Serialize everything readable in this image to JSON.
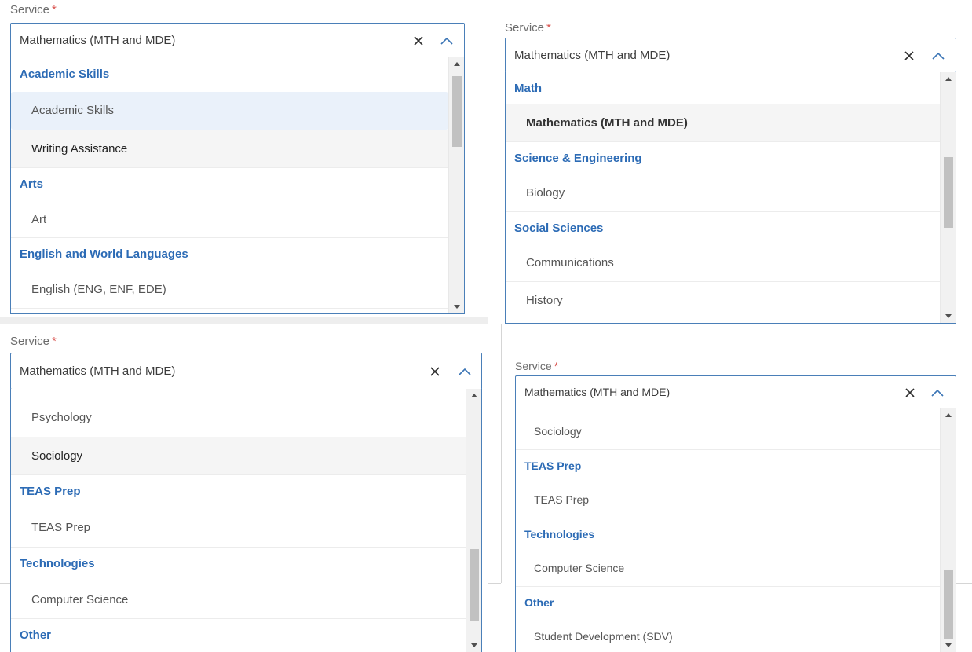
{
  "colors": {
    "accent_border": "#4a7fb8",
    "group_heading": "#2c6bb5",
    "required_star": "#d9534f",
    "hover_bg": "#eaf1fa"
  },
  "panels": [
    {
      "label": "Service",
      "required_mark": "*",
      "selected_value": "Mathematics (MTH and MDE)",
      "clear_icon": "close-icon",
      "toggle_icon": "chevron-up-icon",
      "scroll_position": "top",
      "options": [
        {
          "type": "group",
          "text": "Academic Skills"
        },
        {
          "type": "item",
          "text": "Academic Skills",
          "state": "hovered"
        },
        {
          "type": "item",
          "text": "Writing Assistance",
          "state": "focused"
        },
        {
          "type": "group",
          "text": "Arts"
        },
        {
          "type": "item",
          "text": "Art"
        },
        {
          "type": "group",
          "text": "English and World Languages"
        },
        {
          "type": "item",
          "text": "English (ENG, ENF, EDE)"
        }
      ]
    },
    {
      "label": "Service",
      "required_mark": "*",
      "selected_value": "Mathematics (MTH and MDE)",
      "clear_icon": "close-icon",
      "toggle_icon": "chevron-up-icon",
      "scroll_position": "upper-middle",
      "options": [
        {
          "type": "group",
          "text": "Math"
        },
        {
          "type": "item",
          "text": "Mathematics (MTH and MDE)",
          "state": "selected"
        },
        {
          "type": "group",
          "text": "Science & Engineering"
        },
        {
          "type": "item",
          "text": "Biology"
        },
        {
          "type": "group",
          "text": "Social Sciences"
        },
        {
          "type": "item",
          "text": "Communications"
        },
        {
          "type": "item",
          "text": "History"
        }
      ]
    },
    {
      "label": "Service",
      "required_mark": "*",
      "selected_value": "Mathematics (MTH and MDE)",
      "clear_icon": "close-icon",
      "toggle_icon": "chevron-up-icon",
      "scroll_position": "lower-middle",
      "options": [
        {
          "type": "item",
          "text": "Psychology"
        },
        {
          "type": "item",
          "text": "Sociology",
          "state": "focused"
        },
        {
          "type": "group",
          "text": "TEAS Prep"
        },
        {
          "type": "item",
          "text": "TEAS Prep"
        },
        {
          "type": "group",
          "text": "Technologies"
        },
        {
          "type": "item",
          "text": "Computer Science"
        },
        {
          "type": "group",
          "text": "Other"
        }
      ]
    },
    {
      "label": "Service",
      "required_mark": "*",
      "selected_value": "Mathematics (MTH and MDE)",
      "clear_icon": "close-icon",
      "toggle_icon": "chevron-up-icon",
      "scroll_position": "bottom",
      "options": [
        {
          "type": "item",
          "text": "Sociology"
        },
        {
          "type": "group",
          "text": "TEAS Prep"
        },
        {
          "type": "item",
          "text": "TEAS Prep"
        },
        {
          "type": "group",
          "text": "Technologies"
        },
        {
          "type": "item",
          "text": "Computer Science"
        },
        {
          "type": "group",
          "text": "Other"
        },
        {
          "type": "item",
          "text": "Student Development (SDV)"
        }
      ]
    }
  ]
}
